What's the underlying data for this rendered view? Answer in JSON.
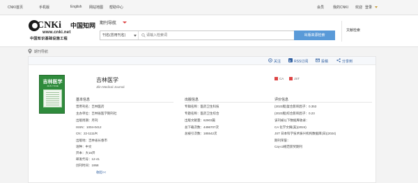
{
  "topnav": {
    "left_links": [
      "CNKI首页",
      "手机版",
      "English",
      "网站地图",
      "帮助中心"
    ],
    "right_links": [
      "会员",
      "我的CNKI",
      "欢迎",
      "登录"
    ]
  },
  "header": {
    "logo": {
      "brand": "CNKi",
      "chinese": "中国知网",
      "url": "www.cnki.net",
      "slogan": "中国知识基础设施工程"
    },
    "nav_label": "期刊导航",
    "search": {
      "scope": "刊名(曾用刊名)",
      "placeholder": "请输入检索词",
      "button": "出版来源检索"
    },
    "advanced": "文献检索"
  },
  "breadcrumb": "期刊导航",
  "actions": [
    "关注",
    "RSS订阅",
    "投稿",
    "分享到"
  ],
  "journal": {
    "title": "吉林医学",
    "subtitle_en": "Jilin Medical Journal",
    "cover_title": "吉林医学",
    "cover_en": "JILIN YIXUE",
    "badges": [
      "CA",
      "JST"
    ]
  },
  "basic_info": {
    "heading": "基本信息",
    "fields": [
      "曾用刊名：吉林医药",
      "主办单位：吉林省医学期刊社",
      "出版周期：月刊",
      "ISSN：1004-0412",
      "CN：22-1111/R",
      "出版地：吉林省长春市",
      "语种：中文",
      "开本：大16开",
      "邮发代号：12-41",
      "创刊时间：1958"
    ]
  },
  "publish_info": {
    "heading": "出版信息",
    "fields": [
      "专辑名称：医药卫生科技",
      "专题名称：医药卫生综合",
      "出版文献量：62903篇",
      "总下载次数：4496707次",
      "总被引次数：185542次"
    ]
  },
  "eval_info": {
    "heading": "评价信息",
    "fields": [
      "(2023版)复合影响因子：0.353",
      "(2023版)综合影响因子：0.23",
      "该刊被以下数据库收录：",
      "CA 化学文摘(美)(2024)",
      "JST 日本科学技术振兴机构数据库(日)(2024)",
      "期刊荣誉：",
      "Caj-cd规范获奖期刊"
    ]
  },
  "more_link": "收起<<"
}
